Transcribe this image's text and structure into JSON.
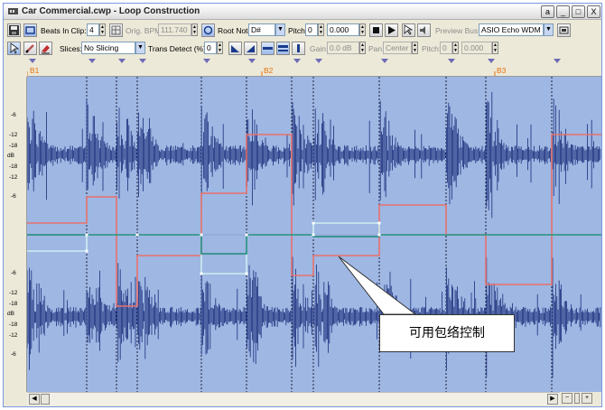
{
  "window": {
    "title": "Car Commercial.cwp - Loop Construction",
    "buttons": {
      "pin": "a",
      "minimize": "_",
      "maximize": "□",
      "close": "X"
    }
  },
  "toolbar1": {
    "beats_label": "Beats In Clip:",
    "beats_value": "4",
    "orig_bpm_label": "Orig. BPM:",
    "orig_bpm_value": "111.740",
    "root_note_label": "Root Note:",
    "root_note_value": "D#",
    "pitch_label": "Pitch:",
    "pitch_value": "0",
    "pitch_fine_value": "0.000",
    "preview_bus_label": "Preview Bus:",
    "preview_bus_value": "ASIO Echo WDM Layl"
  },
  "toolbar2": {
    "slices_label": "Slices:",
    "slices_value": "No Slicing",
    "trans_detect_label": "Trans Detect (%):",
    "trans_detect_value": "0",
    "gain_label": "Gain:",
    "gain_value": "0.0 dB",
    "pan_label": "Pan:",
    "pan_value": "Center",
    "pitch_label": "Pitch:",
    "pitch_value": "0",
    "pitch_fine_value": "0.000"
  },
  "ruler": {
    "markers": [
      "B1",
      "B2",
      "B3"
    ]
  },
  "db_scale": {
    "unit": "dB",
    "ch1_labels": [
      "-6",
      "-12",
      "-18",
      "-18",
      "-12",
      "-6"
    ],
    "ch2_labels": [
      "-6",
      "-12",
      "-18",
      "-18",
      "-12",
      "-6"
    ]
  },
  "annotation": {
    "text": "可用包络控制"
  },
  "colors": {
    "waveform": "#1a2d7a",
    "plot_bg": "#9eb7e3",
    "volume_envelope": "#e8716c",
    "pan_envelope": "#cfeef0",
    "pitch_envelope": "#1e8a78",
    "marker_text": "#e8710c"
  }
}
